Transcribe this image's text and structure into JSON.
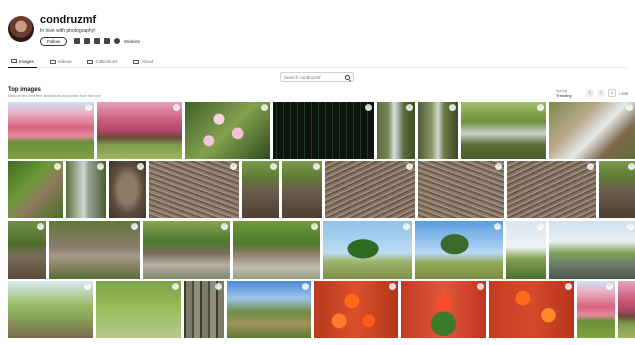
{
  "profile": {
    "username": "condruzmf",
    "tagline": "In love with photography!",
    "follow_label": "Follow",
    "website_label": "Website"
  },
  "tabs": [
    {
      "label": "Images",
      "icon": "image-icon"
    },
    {
      "label": "Videos",
      "icon": "video-icon"
    },
    {
      "label": "Collections",
      "icon": "collection-icon"
    },
    {
      "label": "About",
      "icon": "info-icon"
    }
  ],
  "search": {
    "placeholder": "Search condruzmf"
  },
  "gallery": {
    "title": "Top images",
    "subtitle": "Discover the best free illustrations and photos from this user",
    "sort_label": "Sort by",
    "sort_value": "Trending",
    "page_current": "1",
    "page_total": "/ 209"
  },
  "colors": {
    "accent": "#111111",
    "divider": "#e6e6e6"
  },
  "images": [
    {
      "name": "pink-blossom-trees",
      "art": "t-blossom"
    },
    {
      "name": "pink-blossom-park",
      "art": "t-blossom2"
    },
    {
      "name": "pink-flowers-branch",
      "art": "t-flowers"
    },
    {
      "name": "green-rain-lines",
      "art": "t-rain"
    },
    {
      "name": "waterfall-rocks",
      "art": "t-falls1"
    },
    {
      "name": "waterfall-cliff",
      "art": "t-falls2"
    },
    {
      "name": "waterfall-green",
      "art": "t-falls3"
    },
    {
      "name": "waterfall-cascade",
      "art": "t-falls4"
    },
    {
      "name": "mossy-stream",
      "art": "t-moss"
    },
    {
      "name": "mossy-waterfall",
      "art": "t-mossfall"
    },
    {
      "name": "coin-stump",
      "art": "t-coinstump"
    },
    {
      "name": "coin-wood",
      "art": "t-coins"
    },
    {
      "name": "tree-stump",
      "art": "t-stump"
    },
    {
      "name": "coin-stump-2",
      "art": "t-stump"
    },
    {
      "name": "coins-closeup",
      "art": "t-coins2"
    },
    {
      "name": "coins-closeup-2",
      "art": "t-coins"
    },
    {
      "name": "coins-closeup-3",
      "art": "t-coins2"
    },
    {
      "name": "stump-meadow",
      "art": "t-stump"
    },
    {
      "name": "fallen-log",
      "art": "t-log"
    },
    {
      "name": "stacked-logs",
      "art": "t-logs"
    },
    {
      "name": "wooden-arch",
      "art": "t-arch"
    },
    {
      "name": "wooden-arch-2",
      "art": "t-arch2"
    },
    {
      "name": "lone-tree-field",
      "art": "t-tree1"
    },
    {
      "name": "lone-tree-sky",
      "art": "t-tree2"
    },
    {
      "name": "bare-tree",
      "art": "t-tree3"
    },
    {
      "name": "river-landscape",
      "art": "t-river"
    },
    {
      "name": "wooden-fence-path",
      "art": "t-fence"
    },
    {
      "name": "birds-in-grass",
      "art": "t-birds"
    },
    {
      "name": "pine-forest",
      "art": "t-forest"
    },
    {
      "name": "country-path",
      "art": "t-path"
    },
    {
      "name": "orange-roses",
      "art": "t-rose"
    },
    {
      "name": "red-rose-bush",
      "art": "t-rose2"
    },
    {
      "name": "orange-roses-wall",
      "art": "t-rose3"
    }
  ]
}
